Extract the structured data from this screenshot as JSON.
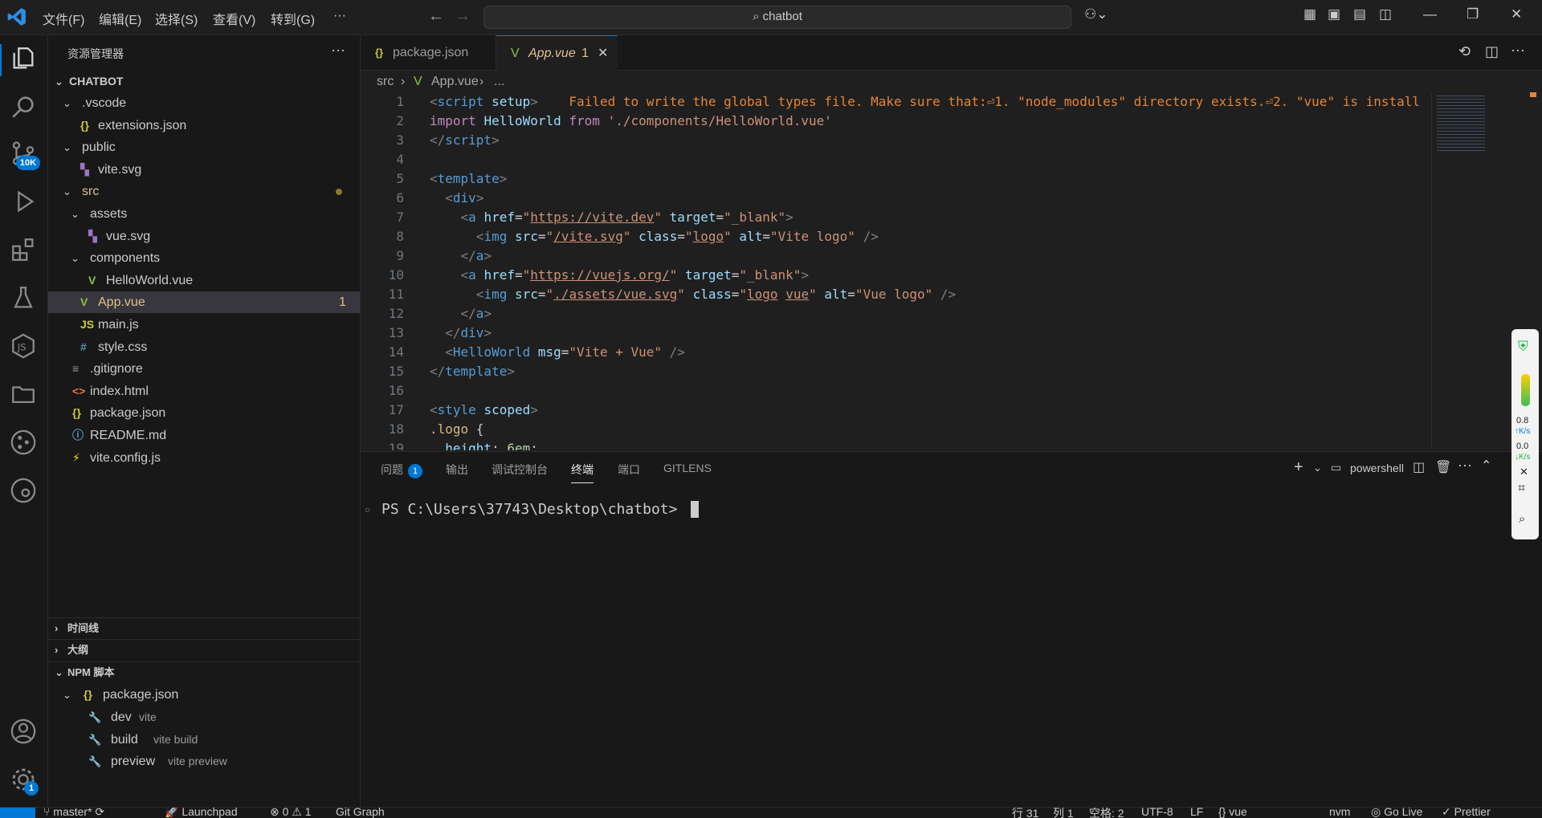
{
  "menu": [
    "文件(F)",
    "编辑(E)",
    "选择(S)",
    "查看(V)",
    "转到(G)",
    "···"
  ],
  "search": {
    "text": "chatbot"
  },
  "activity": {
    "scm_badge": "10K",
    "settings_badge": "1"
  },
  "sidebar": {
    "title": "资源管理器",
    "more": "···",
    "root": "CHATBOT",
    "tree": [
      {
        "label": ".vscode",
        "icon": "chevron",
        "indent": 0
      },
      {
        "label": "extensions.json",
        "icon": "json",
        "indent": 1
      },
      {
        "label": "public",
        "icon": "chevron",
        "indent": 0
      },
      {
        "label": "vite.svg",
        "icon": "svg",
        "indent": 1
      },
      {
        "label": "src",
        "icon": "chevron",
        "indent": 0
      },
      {
        "label": "assets",
        "icon": "chevron",
        "indent": 1
      },
      {
        "label": "vue.svg",
        "icon": "svg",
        "indent": 2
      },
      {
        "label": "components",
        "icon": "chevron",
        "indent": 1
      },
      {
        "label": "HelloWorld.vue",
        "icon": "vue",
        "indent": 2
      },
      {
        "label": "App.vue",
        "icon": "vue",
        "indent": 1,
        "count": "1"
      },
      {
        "label": "main.js",
        "icon": "js",
        "indent": 1
      },
      {
        "label": "style.css",
        "icon": "css",
        "indent": 1
      },
      {
        "label": ".gitignore",
        "icon": "git",
        "indent": 0
      },
      {
        "label": "index.html",
        "icon": "html",
        "indent": 0
      },
      {
        "label": "package.json",
        "icon": "json",
        "indent": 0
      },
      {
        "label": "README.md",
        "icon": "info",
        "indent": 0
      },
      {
        "label": "vite.config.js",
        "icon": "bolt",
        "indent": 0
      }
    ],
    "sections": {
      "timeline": "时间线",
      "outline": "大纲",
      "npm": "NPM 脚本"
    },
    "npm": {
      "package": "package.json",
      "scripts": [
        {
          "name": "dev",
          "cmd": "vite"
        },
        {
          "name": "build",
          "cmd": "vite build"
        },
        {
          "name": "preview",
          "cmd": "vite preview"
        }
      ]
    }
  },
  "tabs": [
    {
      "label": "package.json",
      "active": false
    },
    {
      "label": "App.vue",
      "active": true,
      "count": "1",
      "close": "✕"
    }
  ],
  "breadcrumbs": {
    "folder": "src",
    "file": "App.vue",
    "rest": "..."
  },
  "editor": {
    "line_numbers": [
      "1",
      "2",
      "3",
      "4",
      "5",
      "6",
      "7",
      "8",
      "9",
      "10",
      "11",
      "12",
      "13",
      "14",
      "15",
      "16",
      "17",
      "18",
      "19"
    ],
    "inline_warning": "Failed to write the global types file. Make sure that:⏎1. \"node_modules\" directory exists.⏎2. \"vue\" is install"
  },
  "panel": {
    "tabs": [
      "问题",
      "输出",
      "调试控制台",
      "终端",
      "端口",
      "GITLENS"
    ],
    "problems_count": "1",
    "shell": "powershell",
    "prompt": "PS C:\\Users\\37743\\Desktop\\chatbot>"
  },
  "widget": {
    "down": "0.8",
    "down_unit": "K/s",
    "up": "0.0",
    "up_unit": "K/s"
  },
  "statusbar": {
    "branch": "master*",
    "launchpad": "Launchpad",
    "errors": "0",
    "warnings": "1",
    "gitgraph": "Git Graph",
    "line": "行 31",
    "col": "列 1",
    "spaces": "空格: 2",
    "encoding": "UTF-8",
    "eol": "LF",
    "lang": "vue",
    "npm": "nvm",
    "golive": "Go Live",
    "prettier": "Prettier"
  }
}
